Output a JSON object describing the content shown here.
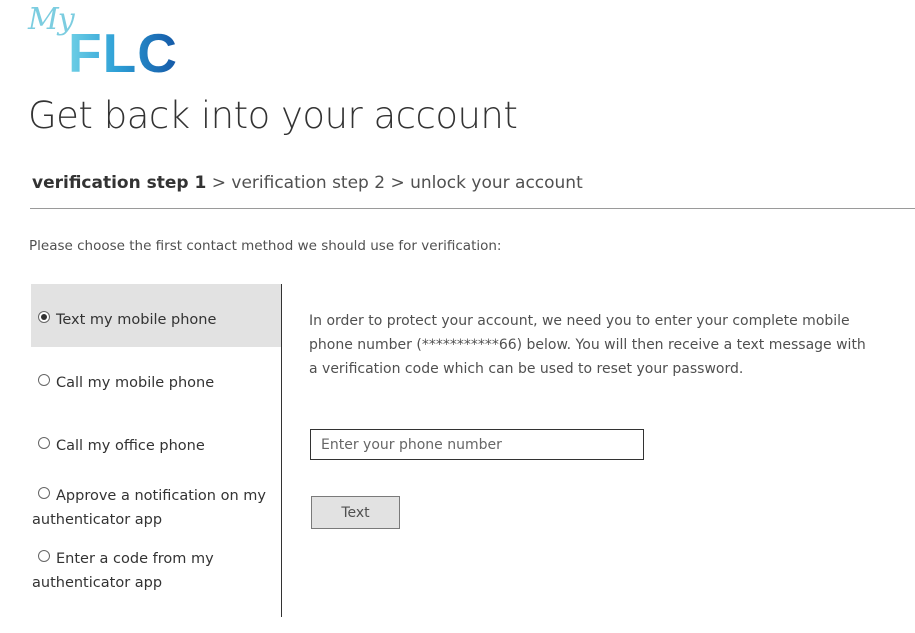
{
  "logo": {
    "script_text": "My",
    "main_text": "FLC"
  },
  "page_title": "Get back into your account",
  "breadcrumb": {
    "step1": "verification step 1",
    "separator": ">",
    "step2": "verification step 2",
    "step3": "unlock your account"
  },
  "prompt": "Please choose the first contact method we should use for verification:",
  "methods": [
    {
      "label": "Text my mobile phone",
      "selected": true
    },
    {
      "label": "Call my mobile phone",
      "selected": false
    },
    {
      "label": "Call my office phone",
      "selected": false
    },
    {
      "label": "Approve a notification on my authenticator app",
      "selected": false
    },
    {
      "label": "Enter a code from my authenticator app",
      "selected": false
    }
  ],
  "info_text": "In order to protect your account, we need you to enter your complete mobile phone number (***********66) below. You will then receive a text message with a verification code which can be used to reset your password.",
  "phone_input": {
    "value": "",
    "placeholder": "Enter your phone number"
  },
  "text_button": "Text",
  "colors": {
    "selected_background": "#e2e2e2",
    "logo_light": "#7ccde0",
    "logo_dark": "#1457a6"
  }
}
